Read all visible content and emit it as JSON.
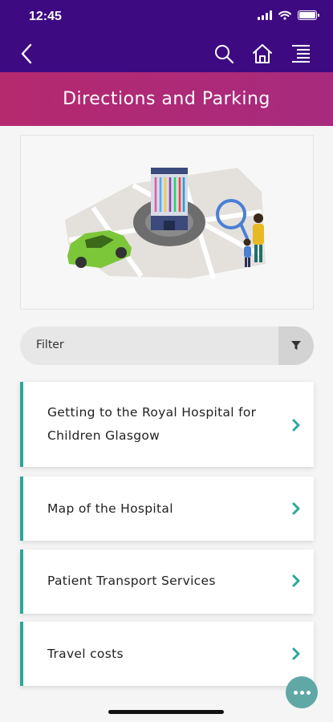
{
  "status_bar": {
    "time": "12:45"
  },
  "nav": {
    "back_icon": "back-chevron-icon",
    "search_icon": "search-icon",
    "home_icon": "home-icon",
    "menu_icon": "menu-icon"
  },
  "page": {
    "title": "Directions and Parking"
  },
  "filter": {
    "label": "Filter",
    "icon": "funnel-icon"
  },
  "items": [
    {
      "label": "Getting to the Royal Hospital for Children Glasgow"
    },
    {
      "label": "Map of the Hospital"
    },
    {
      "label": "Patient Transport Services"
    },
    {
      "label": "Travel costs"
    }
  ],
  "colors": {
    "header": "#3e0a82",
    "title_bar": "#b5296f",
    "accent": "#2aa89a",
    "fab": "#5fa8a6"
  }
}
